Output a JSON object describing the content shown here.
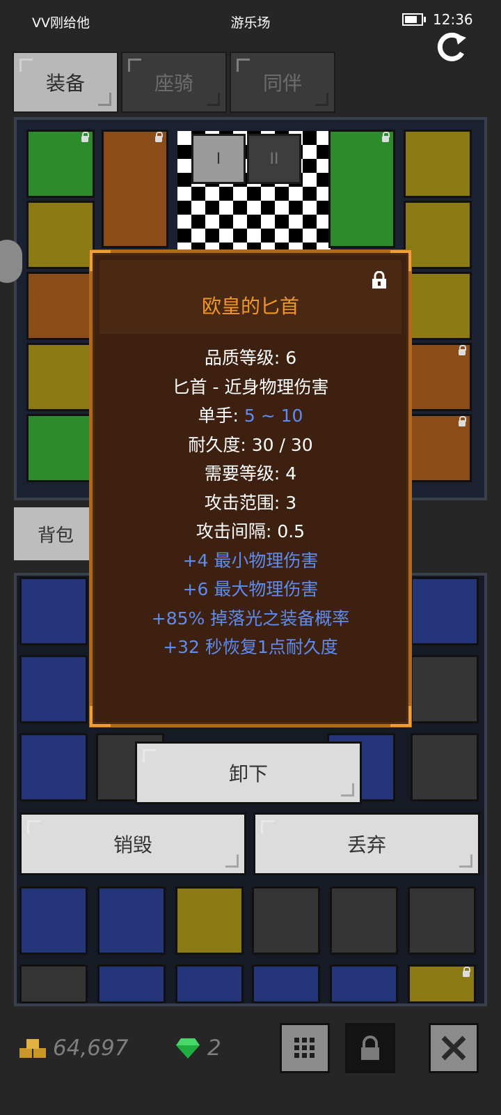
{
  "status_bar": {
    "left_text": "VV刚给他",
    "center_text": "游乐场",
    "time": "12:36",
    "battery_level": 0.75
  },
  "tabs": [
    {
      "label": "装备",
      "active": true
    },
    {
      "label": "座骑",
      "active": false
    },
    {
      "label": "同伴",
      "active": false
    }
  ],
  "set_buttons": [
    "I",
    "II"
  ],
  "bag": {
    "tab_label": "背包"
  },
  "item_popup": {
    "name": "欧皇的匕首",
    "quality_label": "品质等级",
    "quality_value": "6",
    "type_line": "匕首 - 近身物理伤害",
    "handed_label": "单手",
    "damage_range": "5 ~ 10",
    "durability_label": "耐久度",
    "durability_value": "30 / 30",
    "level_req_label": "需要等级",
    "level_req_value": "4",
    "range_label": "攻击范围",
    "range_value": "3",
    "interval_label": "攻击间隔",
    "interval_value": "0.5",
    "bonuses": [
      "+4 最小物理伤害",
      "+6 最大物理伤害",
      "+85% 掉落光之装备概率",
      "+32 秒恢复1点耐久度"
    ],
    "colors": {
      "title": "#f0962a",
      "bonus": "#5e8cf0",
      "frame": "#b06a1a"
    }
  },
  "actions": {
    "unequip": "卸下",
    "destroy": "销毁",
    "discard": "丢弃"
  },
  "footer": {
    "gold": "64,697",
    "gems": "2"
  }
}
